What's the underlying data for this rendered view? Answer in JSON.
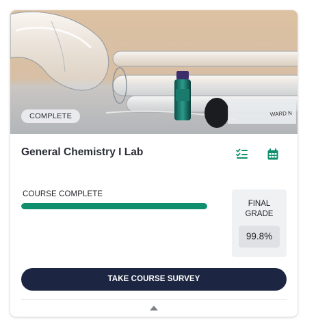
{
  "course": {
    "badge": "COMPLETE",
    "title": "General Chemistry I Lab",
    "progress_label": "COURSE COMPLETE",
    "progress_fraction": 1.0,
    "grade_label_line1": "FINAL",
    "grade_label_line2": "GRADE",
    "grade_value": "99.8%",
    "survey_button": "TAKE COURSE SURVEY"
  },
  "icons": {
    "checklist": "checklist-icon",
    "calendar": "calendar-icon",
    "collapse": "caret-up-icon"
  },
  "colors": {
    "accent": "#0f8f6d",
    "button": "#1c2541"
  }
}
